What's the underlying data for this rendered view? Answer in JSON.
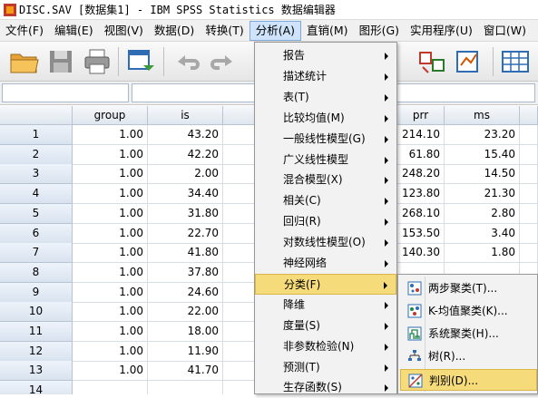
{
  "window": {
    "title": "DISC.SAV [数据集1] - IBM SPSS Statistics 数据编辑器"
  },
  "menubar": {
    "items": [
      "文件(F)",
      "编辑(E)",
      "视图(V)",
      "数据(D)",
      "转换(T)",
      "分析(A)",
      "直销(M)",
      "图形(G)",
      "实用程序(U)",
      "窗口(W)"
    ],
    "active": "分析(A)"
  },
  "toolbar": {
    "icons": [
      "open-folder-icon",
      "save-icon",
      "print-icon",
      "dialog-recall-icon",
      "undo-icon",
      "redo-icon",
      "split-file-icon",
      "weight-cases-icon",
      "value-labels-icon"
    ]
  },
  "cellbar": {
    "cell_name": "",
    "cell_value": ""
  },
  "grid": {
    "columns": [
      "group",
      "is",
      "",
      "prr",
      "ms"
    ],
    "rows": [
      {
        "n": "1",
        "group": "1.00",
        "is": "43.20",
        "prr": "214.10",
        "ms": "23.20"
      },
      {
        "n": "2",
        "group": "1.00",
        "is": "42.20",
        "prr": "61.80",
        "ms": "15.40"
      },
      {
        "n": "3",
        "group": "1.00",
        "is": "2.00",
        "prr": "248.20",
        "ms": "14.50"
      },
      {
        "n": "4",
        "group": "1.00",
        "is": "34.40",
        "prr": "123.80",
        "ms": "21.30"
      },
      {
        "n": "5",
        "group": "1.00",
        "is": "31.80",
        "prr": "268.10",
        "ms": "2.80"
      },
      {
        "n": "6",
        "group": "1.00",
        "is": "22.70",
        "prr": "153.50",
        "ms": "3.40"
      },
      {
        "n": "7",
        "group": "1.00",
        "is": "41.80",
        "prr": "140.30",
        "ms": "1.80"
      },
      {
        "n": "8",
        "group": "1.00",
        "is": "37.80",
        "prr": "",
        "ms": ""
      },
      {
        "n": "9",
        "group": "1.00",
        "is": "24.60",
        "prr": "",
        "ms": ""
      },
      {
        "n": "10",
        "group": "1.00",
        "is": "22.00",
        "prr": "",
        "ms": ""
      },
      {
        "n": "11",
        "group": "1.00",
        "is": "18.00",
        "prr": "",
        "ms": ""
      },
      {
        "n": "12",
        "group": "1.00",
        "is": "11.90",
        "prr": "",
        "ms": ""
      },
      {
        "n": "13",
        "group": "1.00",
        "is": "41.70",
        "prr": "",
        "ms": ""
      },
      {
        "n": "14",
        "group": "",
        "is": "",
        "prr": "",
        "ms": ""
      }
    ]
  },
  "analyze_menu": {
    "items": [
      {
        "label": "报告",
        "submenu": true
      },
      {
        "label": "描述统计",
        "submenu": true
      },
      {
        "label": "表(T)",
        "submenu": true
      },
      {
        "label": "比较均值(M)",
        "submenu": true
      },
      {
        "label": "一般线性模型(G)",
        "submenu": true
      },
      {
        "label": "广义线性模型",
        "submenu": true
      },
      {
        "label": "混合模型(X)",
        "submenu": true
      },
      {
        "label": "相关(C)",
        "submenu": true
      },
      {
        "label": "回归(R)",
        "submenu": true
      },
      {
        "label": "对数线性模型(O)",
        "submenu": true
      },
      {
        "label": "神经网络",
        "submenu": true
      },
      {
        "label": "分类(F)",
        "submenu": true
      },
      {
        "label": "降维",
        "submenu": true
      },
      {
        "label": "度量(S)",
        "submenu": true
      },
      {
        "label": "非参数检验(N)",
        "submenu": true
      },
      {
        "label": "预测(T)",
        "submenu": true
      },
      {
        "label": "生存函数(S)",
        "submenu": true
      }
    ],
    "highlighted": "分类(F)"
  },
  "classify_submenu": {
    "items": [
      {
        "label": "两步聚类(T)...",
        "icon": "twostep-cluster-icon"
      },
      {
        "label": "K-均值聚类(K)...",
        "icon": "kmeans-cluster-icon"
      },
      {
        "label": "系统聚类(H)...",
        "icon": "hierarchical-cluster-icon"
      },
      {
        "label": "树(R)...",
        "icon": "tree-icon"
      },
      {
        "label": "判别(D)...",
        "icon": "discriminant-icon"
      }
    ],
    "highlighted": "判别(D)..."
  },
  "colors": {
    "menu_highlight": "#f6db7a",
    "active_menu": "#cfe4fb",
    "header": "#dfe6ee"
  }
}
